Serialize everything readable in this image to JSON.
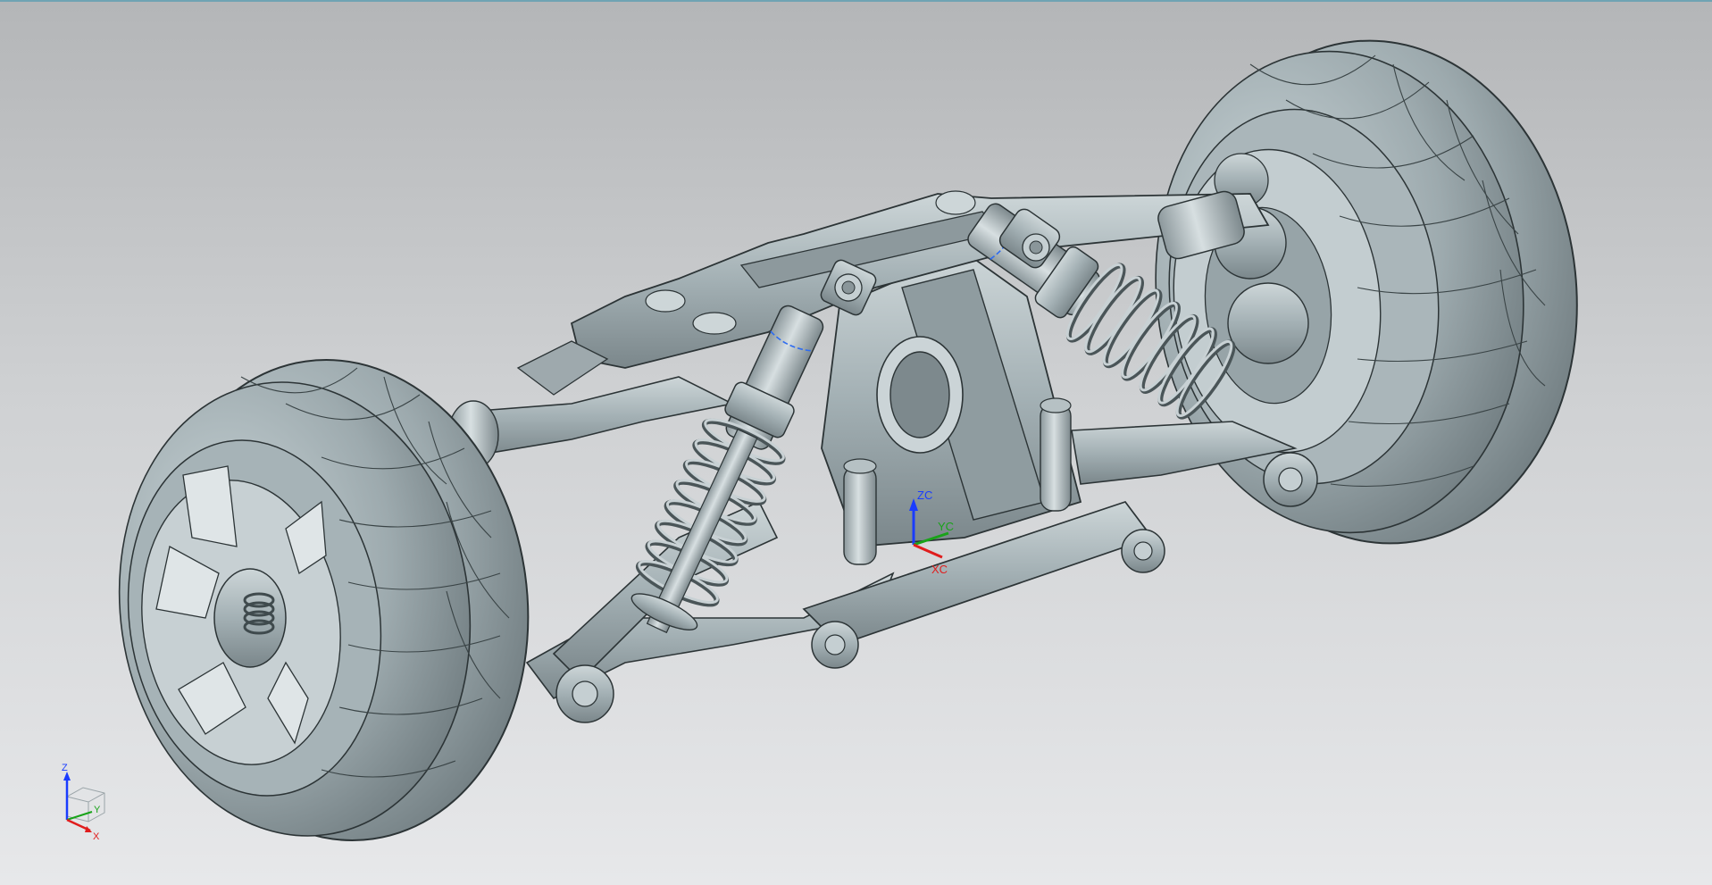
{
  "viewport": {
    "background_top": "#b4b6b8",
    "background_bottom": "#e7e8ea",
    "frame_accent": "#6fa3b3"
  },
  "model": {
    "part_color": "#a9b7bb",
    "edge_color": "#2c3436",
    "highlight_color": "#2e6cf0"
  },
  "wcs": {
    "z_label": "ZC",
    "y_label": "YC",
    "x_label": "XC",
    "z_color": "#1a3cff",
    "y_color": "#19a319",
    "x_color": "#e01d1d"
  },
  "view_triad": {
    "z_label": "Z",
    "y_label": "Y",
    "x_label": "X"
  }
}
